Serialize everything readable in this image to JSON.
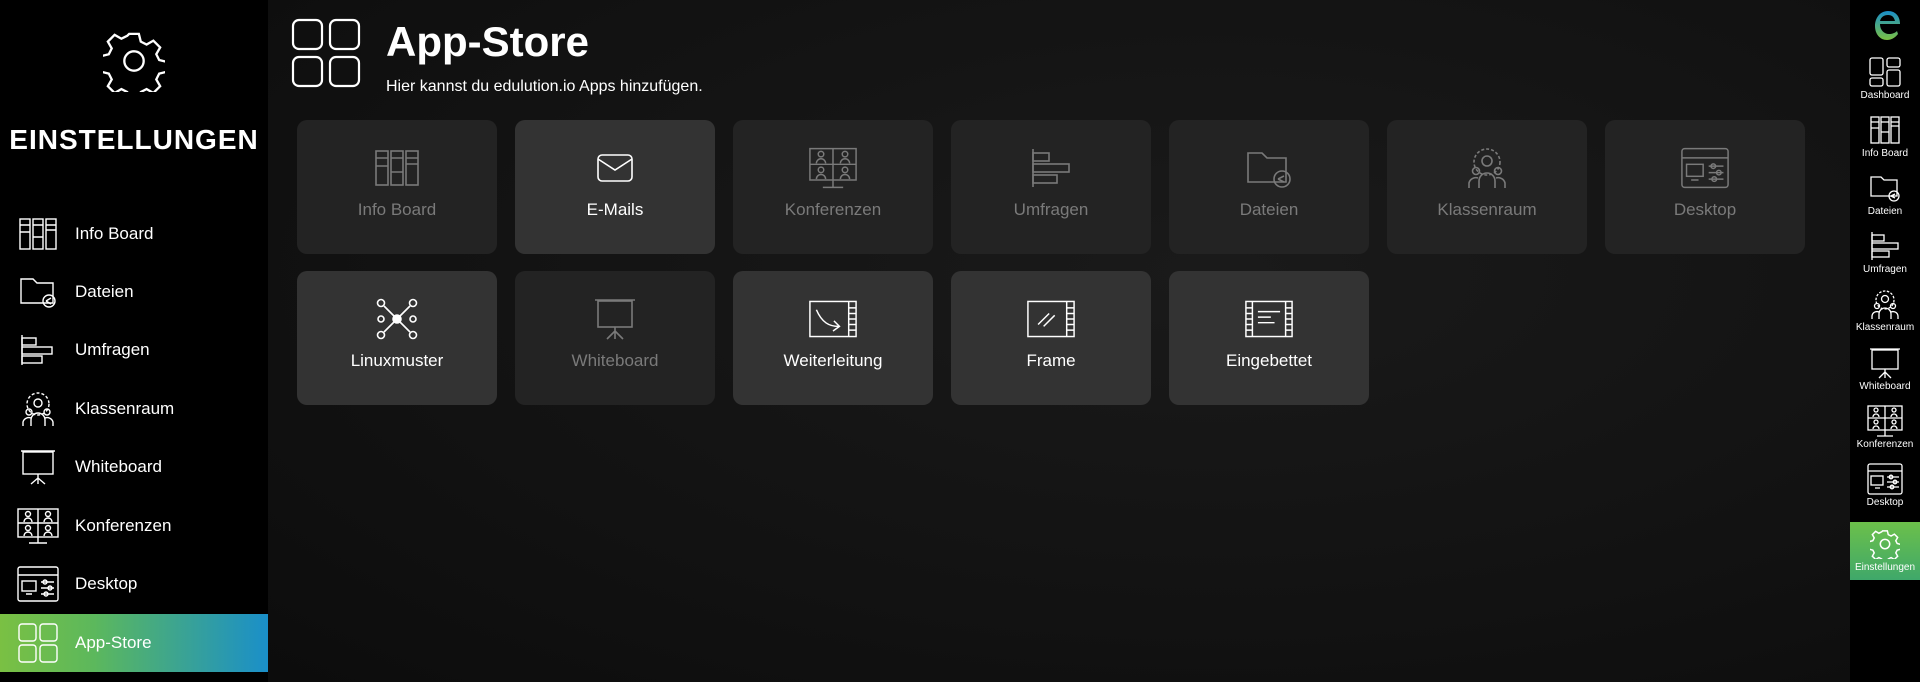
{
  "sidebar": {
    "title": "EINSTELLUNGEN",
    "items": [
      {
        "label": "Info Board",
        "icon": "info-board-icon"
      },
      {
        "label": "Dateien",
        "icon": "folder-share-icon"
      },
      {
        "label": "Umfragen",
        "icon": "survey-bars-icon"
      },
      {
        "label": "Klassenraum",
        "icon": "classroom-icon"
      },
      {
        "label": "Whiteboard",
        "icon": "whiteboard-icon"
      },
      {
        "label": "Konferenzen",
        "icon": "conference-icon"
      },
      {
        "label": "Desktop",
        "icon": "desktop-icon"
      },
      {
        "label": "App-Store",
        "icon": "app-store-icon",
        "active": true
      }
    ]
  },
  "header": {
    "title": "App-Store",
    "subtitle": "Hier kannst du edulution.io Apps hinzufügen."
  },
  "apps": [
    {
      "label": "Info Board",
      "enabled": false
    },
    {
      "label": "E-Mails",
      "enabled": true
    },
    {
      "label": "Konferenzen",
      "enabled": false
    },
    {
      "label": "Umfragen",
      "enabled": false
    },
    {
      "label": "Dateien",
      "enabled": false
    },
    {
      "label": "Klassenraum",
      "enabled": false
    },
    {
      "label": "Desktop",
      "enabled": false
    },
    {
      "label": "Linuxmuster",
      "enabled": true
    },
    {
      "label": "Whiteboard",
      "enabled": false
    },
    {
      "label": "Weiterleitung",
      "enabled": true
    },
    {
      "label": "Frame",
      "enabled": true
    },
    {
      "label": "Eingebettet",
      "enabled": true
    }
  ],
  "rail": {
    "items": [
      {
        "label": "Dashboard"
      },
      {
        "label": "Info Board"
      },
      {
        "label": "Dateien"
      },
      {
        "label": "Umfragen"
      },
      {
        "label": "Klassenraum"
      },
      {
        "label": "Whiteboard"
      },
      {
        "label": "Konferenzen"
      },
      {
        "label": "Desktop"
      },
      {
        "label": "Einstellungen",
        "active": true
      }
    ]
  },
  "colors": {
    "accent_green": "#7ac043",
    "accent_blue": "#1a8fc9",
    "tile_enabled": "#333333",
    "tile_disabled": "#232323"
  }
}
